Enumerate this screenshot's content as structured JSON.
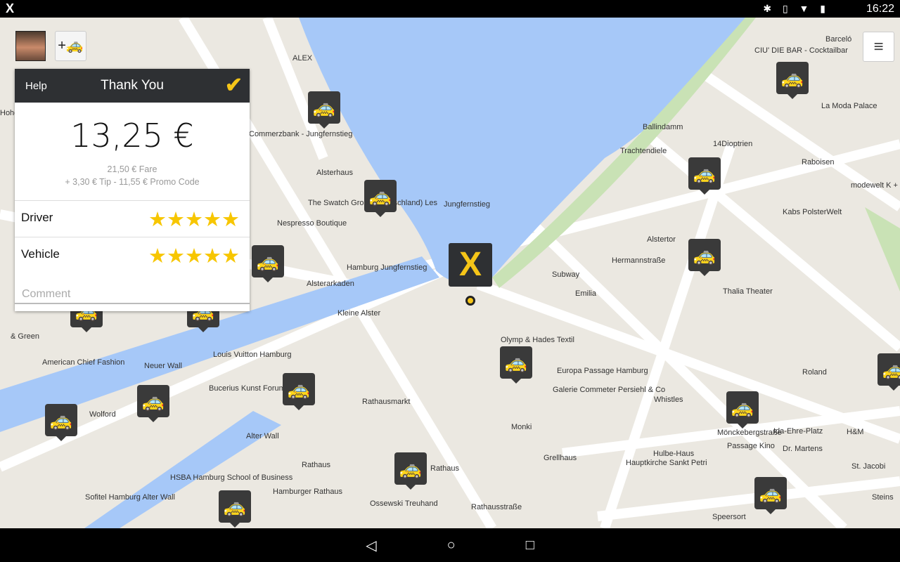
{
  "status": {
    "time": "16:22",
    "icons": [
      "bluetooth-icon",
      "vibrate-icon",
      "wifi-icon",
      "battery-icon"
    ]
  },
  "colors": {
    "accent": "#f5c518",
    "header": "#2e3033",
    "water": "#a6c8f8"
  },
  "map": {
    "labels": [
      "ALEX",
      "Commerzbank - Jungfernstieg",
      "Alsterhaus",
      "The Swatch Group (Deutschland) Les",
      "Nespresso Boutique",
      "Jungfernstieg",
      "Hamburg Jungfernstieg",
      "Alsterarkaden",
      "Kleine Alster",
      "Louis Vuitton Hamburg",
      "American Chief Fashion",
      "Bucerius Kunst Forum",
      "Wolford",
      "Rathausmarkt",
      "Rathaus",
      "HSBA Hamburg School of Business",
      "Sofitel Hamburg Alter Wall",
      "Hamburger Rathaus",
      "Ossewski Treuhand",
      "Rathaus",
      "Rathausstraße",
      "Subway",
      "Emilia",
      "Olymp & Hades Textil",
      "Europa Passage Hamburg",
      "Galerie Commeter Persiehl & Co",
      "Monki",
      "Grellhaus",
      "Hulbe-Haus",
      "Hauptkirche Sankt Petri",
      "Passage Kino",
      "Dr. Martens",
      "Ida-Ehre-Platz",
      "H&M",
      "St. Jacobi",
      "Mönckebergstraße",
      "Roland",
      "Whistles",
      "Thalia Theater",
      "Kabs PolsterWelt",
      "modewelt K + J GbR Modegeschäft",
      "14Dioptrien",
      "Trachtendiele",
      "La Moda Palace",
      "CIU' DIE BAR - Cocktailbar",
      "Barceló",
      "Ballindamm",
      "Alstertor",
      "Raboisen",
      "Hermannstraße",
      "Neuer Wall",
      "Alter Wall",
      "Speersort",
      "Steins",
      "& Green",
      "Hohe Bleichen"
    ]
  },
  "panel": {
    "help": "Help",
    "title": "Thank You",
    "total": "13,25 €",
    "fare": "21,50 € Fare",
    "adjust": "+ 3,30 € Tip - 11,55 € Promo Code",
    "driver_label": "Driver",
    "driver_rating": 5,
    "vehicle_label": "Vehicle",
    "vehicle_rating": 5,
    "comment_placeholder": "Comment",
    "stars": "★★★★★"
  }
}
